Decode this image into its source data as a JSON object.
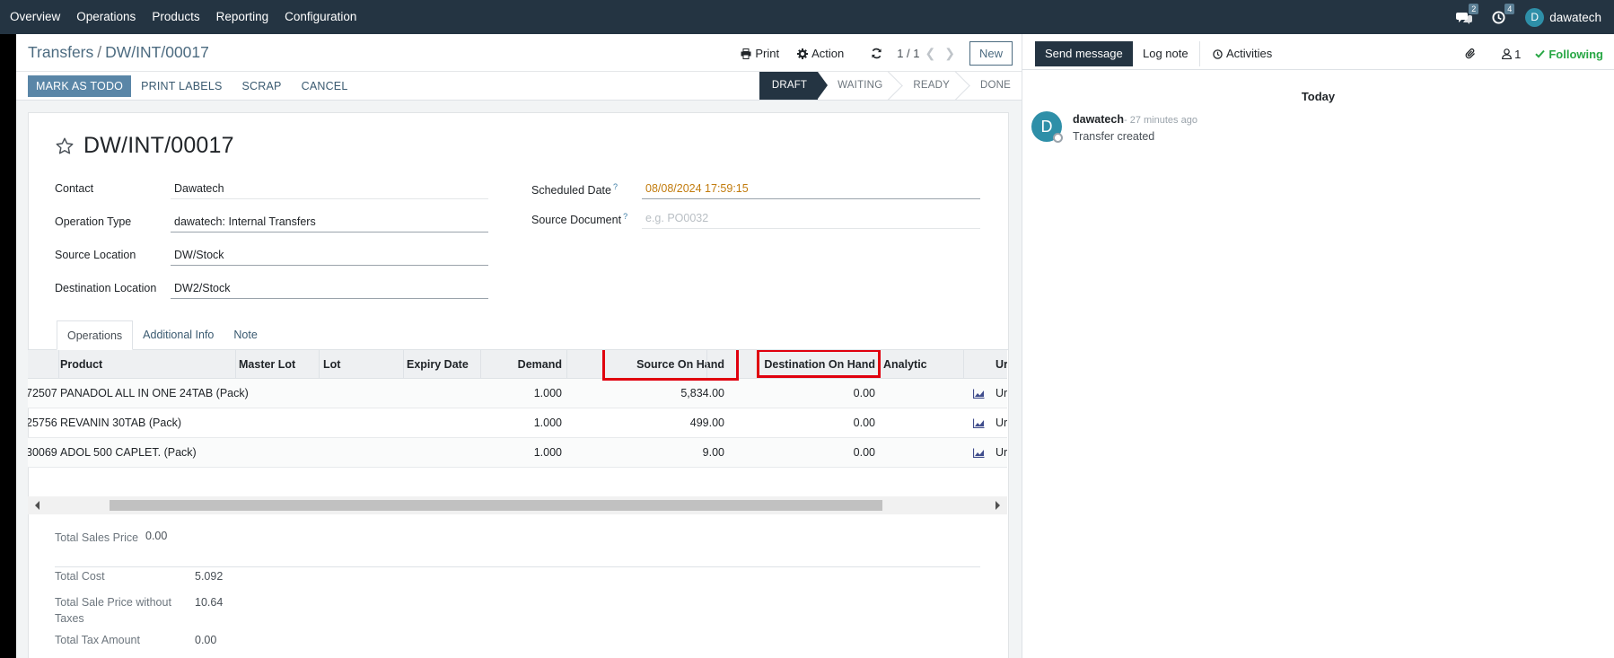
{
  "navbar": {
    "items": [
      "Overview",
      "Operations",
      "Products",
      "Reporting",
      "Configuration"
    ],
    "messages_count": "2",
    "activities_count": "4",
    "user_initial": "D",
    "user_name": "dawatech"
  },
  "control_panel": {
    "breadcrumb_parent": "Transfers",
    "breadcrumb_sep": "/",
    "breadcrumb_current": "DW/INT/00017",
    "print_label": "Print",
    "action_label": "Action",
    "pager": "1 / 1",
    "new_label": "New"
  },
  "buttons": {
    "mark_as_todo": "MARK AS TODO",
    "print_labels": "PRINT LABELS",
    "scrap": "SCRAP",
    "cancel": "CANCEL"
  },
  "statusbar": [
    "DRAFT",
    "WAITING",
    "READY",
    "DONE"
  ],
  "statusbar_active": "DRAFT",
  "form": {
    "title": "DW/INT/00017",
    "contact_label": "Contact",
    "contact_value": "Dawatech",
    "operation_type_label": "Operation Type",
    "operation_type_value": "dawatech: Internal Transfers",
    "source_location_label": "Source Location",
    "source_location_value": "DW/Stock",
    "destination_location_label": "Destination Location",
    "destination_location_value": "DW2/Stock",
    "scheduled_date_label": "Scheduled Date",
    "scheduled_date_value": "08/08/2024 17:59:15",
    "source_document_label": "Source Document",
    "source_document_placeholder": "e.g. PO0032",
    "help_mark": "?"
  },
  "tabs": [
    "Operations",
    "Additional Info",
    "Note"
  ],
  "table": {
    "headers": {
      "product": "Product",
      "master_lot": "Master Lot",
      "lot": "Lot",
      "expiry": "Expiry Date",
      "demand": "Demand",
      "source_on_hand": "Source On Hand",
      "dest_on_hand": "Destination On Hand",
      "analytic": "Analytic",
      "uom": "Ur"
    },
    "rows": [
      {
        "code": "72507",
        "product": "PANADOL ALL IN ONE 24TAB (Pack)",
        "demand": "1.000",
        "source": "5,834.00",
        "dest": "0.00",
        "uom": "Ur"
      },
      {
        "code": "25756",
        "product": "REVANIN 30TAB (Pack)",
        "demand": "1.000",
        "source": "499.00",
        "dest": "0.00",
        "uom": "Ur"
      },
      {
        "code": "30069",
        "product": "ADOL 500 CAPLET. (Pack)",
        "demand": "1.000",
        "source": "9.00",
        "dest": "0.00",
        "uom": "Ur"
      }
    ]
  },
  "totals": {
    "sales_price_label": "Total Sales Price",
    "sales_price_value": "0.00",
    "cost_label": "Total Cost",
    "cost_value": "5.092",
    "sale_wo_taxes_label": "Total Sale Price without Taxes",
    "sale_wo_taxes_value": "10.64",
    "tax_label": "Total Tax Amount",
    "tax_value": "0.00"
  },
  "chatter": {
    "send_message": "Send message",
    "log_note": "Log note",
    "activities": "Activities",
    "followers_count": "1",
    "following": "Following",
    "date_separator": "Today",
    "message": {
      "avatar_initial": "D",
      "author": "dawatech",
      "time": "- 27 minutes ago",
      "body": "Transfer created"
    }
  },
  "colors": {
    "navbar": "#243442",
    "primary_button": "#5a86a7",
    "highlight_box": "#e0000e",
    "following": "#28a745",
    "date_value": "#c27c0e"
  }
}
